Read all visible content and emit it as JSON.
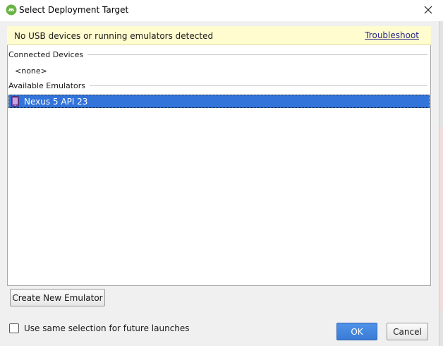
{
  "window": {
    "title": "Select Deployment Target",
    "app_icon": "android-studio-icon",
    "close_icon": "close-icon"
  },
  "banner": {
    "message": "No USB devices or running emulators detected",
    "link_label": "Troubleshoot"
  },
  "device_list": {
    "connected_header": "Connected Devices",
    "connected_none": "<none>",
    "emulators_header": "Available Emulators",
    "emulators": [
      {
        "name": "Nexus 5 API 23",
        "icon": "phone-emulator-icon",
        "selected": true
      }
    ]
  },
  "actions": {
    "create_emulator_label": "Create New Emulator",
    "use_same_label": "Use same selection for future launches",
    "use_same_checked": false,
    "ok_label": "OK",
    "cancel_label": "Cancel"
  },
  "colors": {
    "selection": "#3274d9",
    "banner_bg": "#fffccf",
    "primary_button": "#3a7bd6"
  }
}
